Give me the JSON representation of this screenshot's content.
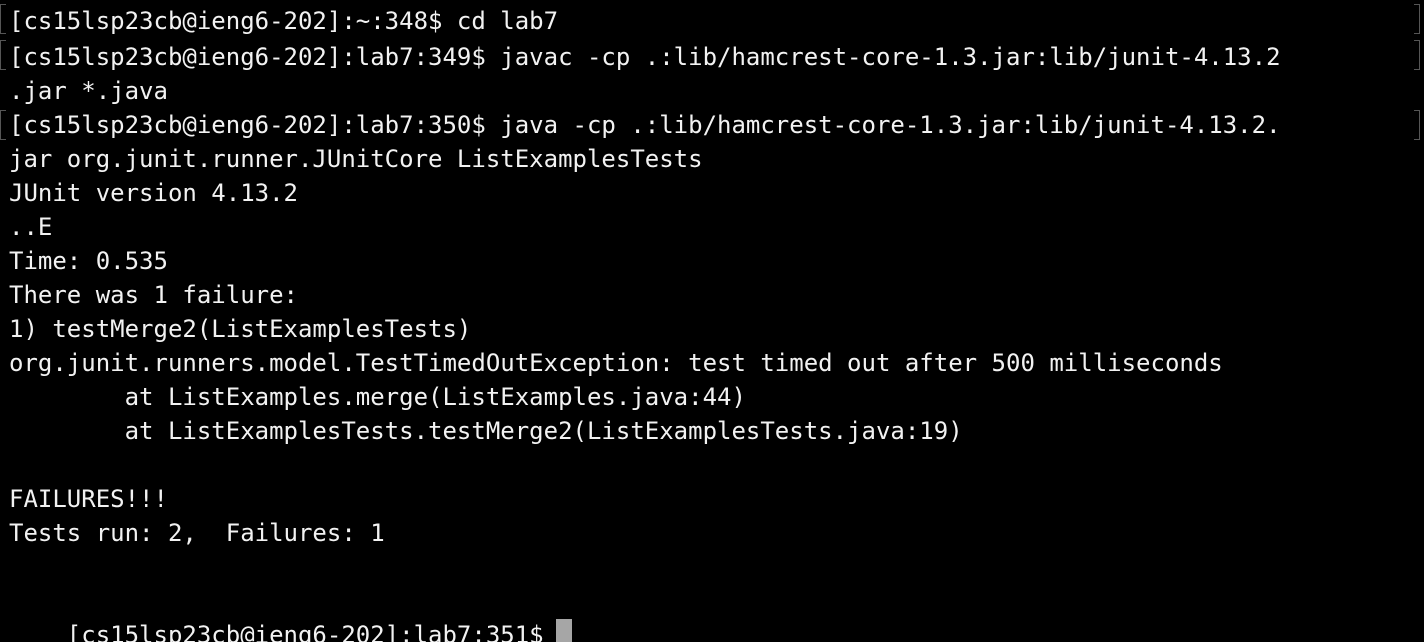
{
  "terminal": {
    "background": "#000000",
    "foreground": "#f2f2f2",
    "cursor_color": "#a6a6a6",
    "lines": [
      "[cs15lsp23cb@ieng6-202]:~:348$ cd lab7",
      "[cs15lsp23cb@ieng6-202]:lab7:349$ javac -cp .:lib/hamcrest-core-1.3.jar:lib/junit-4.13.2",
      ".jar *.java",
      "[cs15lsp23cb@ieng6-202]:lab7:350$ java -cp .:lib/hamcrest-core-1.3.jar:lib/junit-4.13.2.",
      "jar org.junit.runner.JUnitCore ListExamplesTests",
      "JUnit version 4.13.2",
      "..E",
      "Time: 0.535",
      "There was 1 failure:",
      "1) testMerge2(ListExamplesTests)",
      "org.junit.runners.model.TestTimedOutException: test timed out after 500 milliseconds",
      "        at ListExamples.merge(ListExamples.java:44)",
      "        at ListExamplesTests.testMerge2(ListExamplesTests.java:19)",
      "",
      "FAILURES!!!",
      "Tests run: 2,  Failures: 1",
      ""
    ],
    "prompt": "[cs15lsp23cb@ieng6-202]:lab7:351$"
  }
}
